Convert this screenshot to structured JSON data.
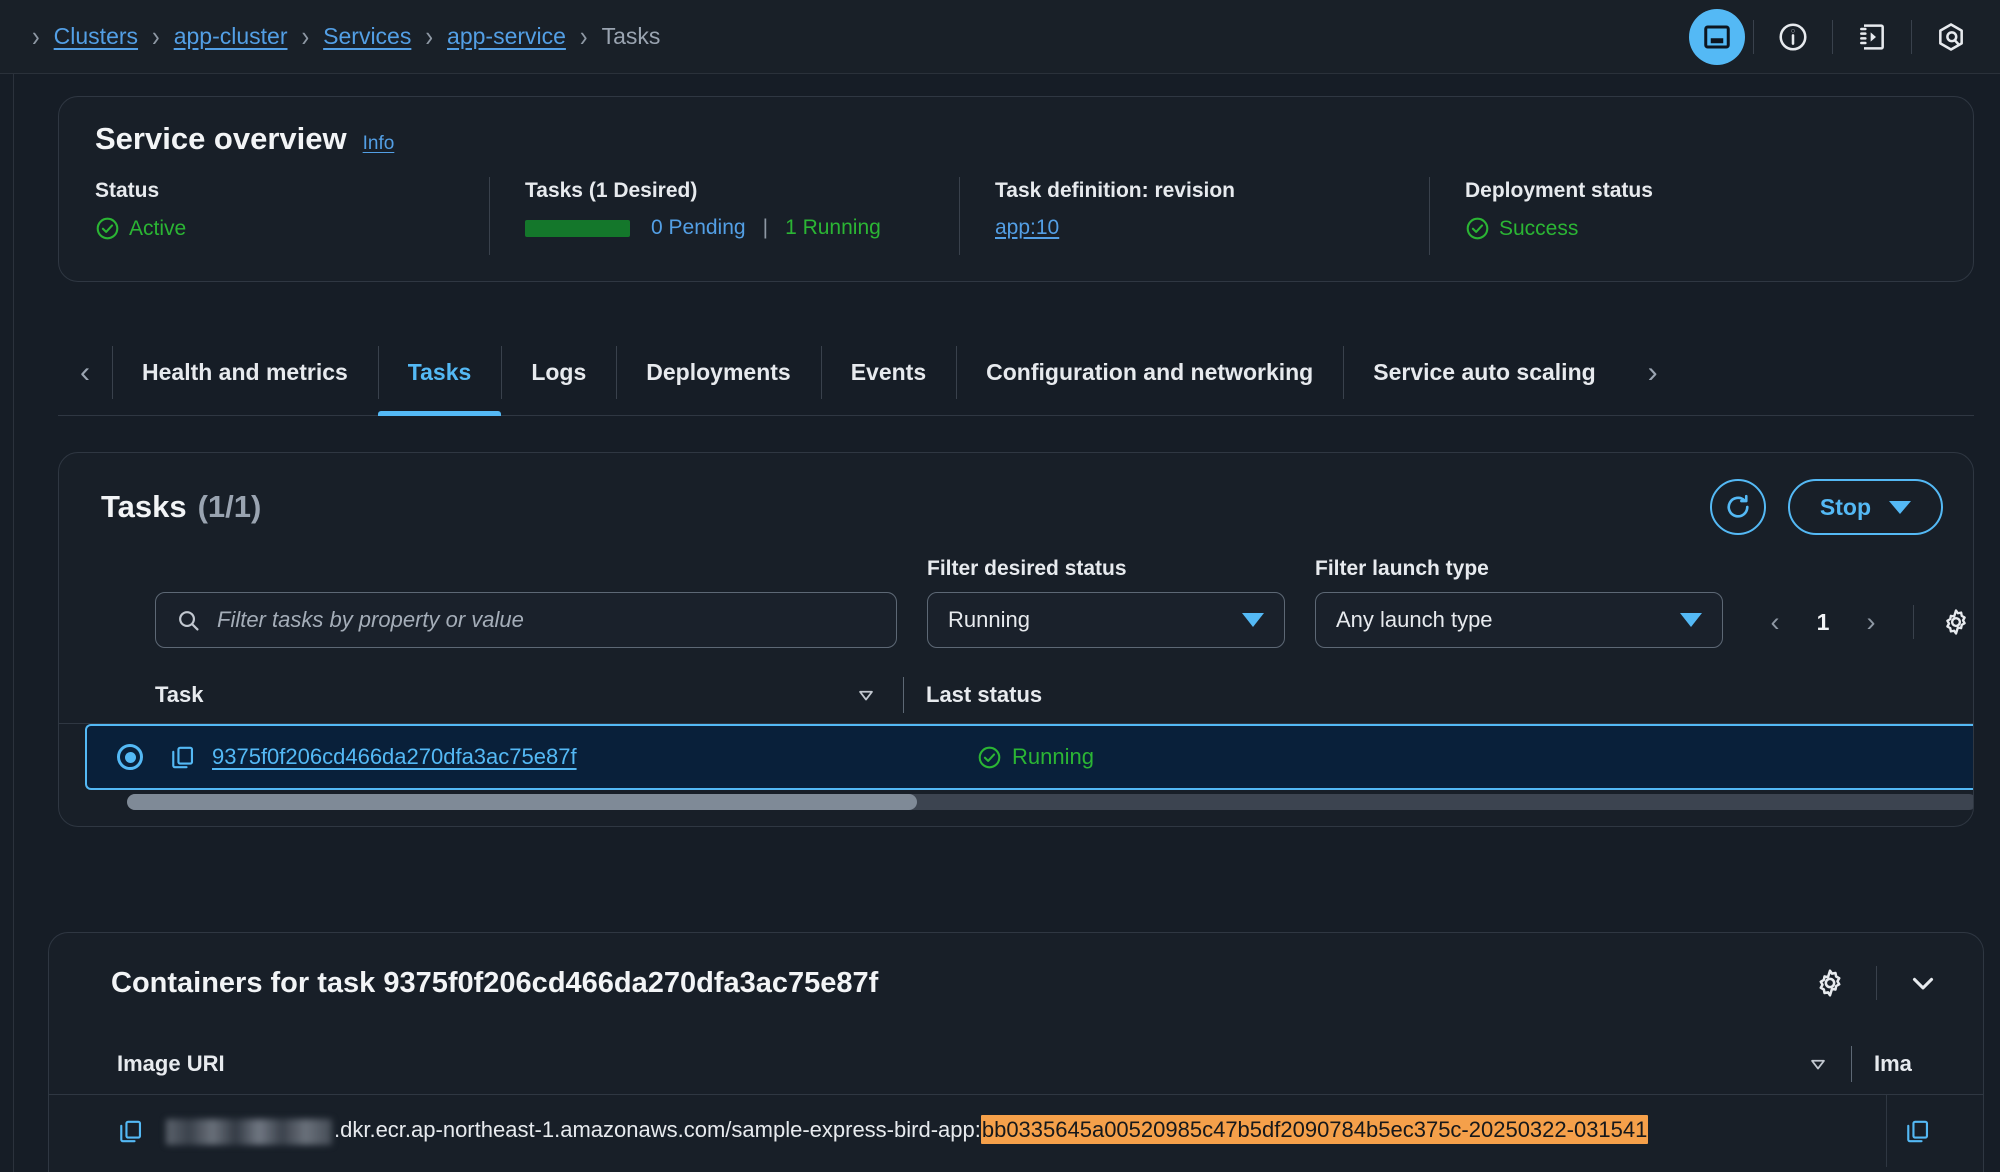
{
  "breadcrumb": {
    "items": [
      {
        "label": "Clusters",
        "link": true
      },
      {
        "label": "app-cluster",
        "link": true
      },
      {
        "label": "Services",
        "link": true
      },
      {
        "label": "app-service",
        "link": true
      },
      {
        "label": "Tasks",
        "link": false
      }
    ],
    "separator": "›"
  },
  "top_icons": [
    {
      "name": "split-panel-icon",
      "label": "Split panel",
      "active": true
    },
    {
      "name": "info-icon",
      "label": "Info"
    },
    {
      "name": "cloudshell-icon",
      "label": "CloudShell"
    },
    {
      "name": "settings-hex-icon",
      "label": "Settings"
    }
  ],
  "overview": {
    "title": "Service overview",
    "info_label": "Info",
    "columns": [
      {
        "label": "Status",
        "value": "Active",
        "icon": "check-circle-icon",
        "color": "#2bb534"
      },
      {
        "label": "Tasks (1 Desired)",
        "pending": "0 Pending",
        "running": "1 Running",
        "divider": "|"
      },
      {
        "label": "Task definition: revision",
        "value": "app:10",
        "link": true
      },
      {
        "label": "Deployment status",
        "value": "Success",
        "icon": "check-circle-icon",
        "color": "#2bb534"
      }
    ]
  },
  "tabs": {
    "prev_arrow": "‹",
    "next_arrow": "›",
    "items": [
      {
        "label": "Health and metrics",
        "selected": false
      },
      {
        "label": "Tasks",
        "selected": true
      },
      {
        "label": "Logs",
        "selected": false
      },
      {
        "label": "Deployments",
        "selected": false
      },
      {
        "label": "Events",
        "selected": false
      },
      {
        "label": "Configuration and networking",
        "selected": false
      },
      {
        "label": "Service auto scaling",
        "selected": false
      }
    ]
  },
  "tasks_panel": {
    "title": "Tasks",
    "count": "(1/1)",
    "refresh_icon": "refresh-icon",
    "stop_button": "Stop",
    "search_placeholder": "Filter tasks by property or value",
    "filters": [
      {
        "label": "Filter desired status",
        "value": "Running"
      },
      {
        "label": "Filter launch type",
        "value": "Any launch type"
      }
    ],
    "pagination": {
      "prev": "‹",
      "page": "1",
      "next": "›"
    },
    "columns": [
      "Task",
      "Last status"
    ],
    "rows": [
      {
        "selected": true,
        "task_id": "9375f0f206cd466da270dfa3ac75e87f",
        "last_status": "Running",
        "status_color": "#2bb534"
      }
    ]
  },
  "containers": {
    "title": "Containers for task 9375f0f206cd466da270dfa3ac75e87f",
    "columns": [
      "Image URI",
      "Ima"
    ],
    "rows": [
      {
        "uri_prefix": ".dkr.ecr.ap-northeast-1.amazonaws.com/sample-express-bird-app:",
        "uri_tag_highlighted": "bb0335645a00520985c47b5df2090784b5ec375c-20250322-031541",
        "redacted": true
      }
    ]
  },
  "colors": {
    "accent": "#54b9f5",
    "success": "#2bb534",
    "highlight": "#f5a04a",
    "background": "#161d26",
    "panel": "#181f28"
  }
}
